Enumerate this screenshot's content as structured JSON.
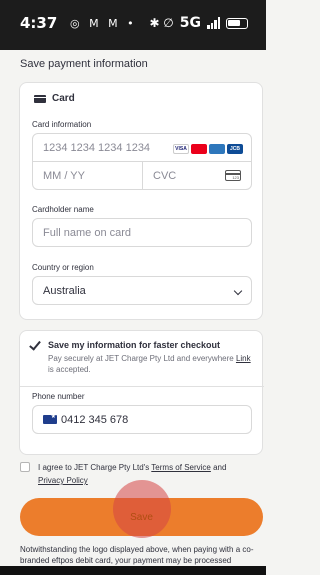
{
  "status_bar": {
    "time": "4:37",
    "left_icons": "◎ M M •",
    "right_icons": "✱ ∅",
    "network": "5G"
  },
  "page": {
    "title": "Save payment information"
  },
  "card_form": {
    "tab_label": "Card",
    "card_info_label": "Card information",
    "card_number_placeholder": "1234 1234 1234 1234",
    "expiry_placeholder": "MM / YY",
    "cvc_placeholder": "CVC",
    "cvc_icon_text": "123",
    "brands": [
      "VISA",
      "MC",
      "AMEX",
      "JCB"
    ],
    "cardholder_label": "Cardholder name",
    "cardholder_placeholder": "Full name on card",
    "country_label": "Country or region",
    "country_value": "Australia"
  },
  "save_info": {
    "checkbox_label": "Save my information for faster checkout",
    "description_prefix": "Pay securely at JET Charge Pty Ltd and everywhere ",
    "link_text": "Link",
    "description_suffix": " is accepted.",
    "phone_label": "Phone number",
    "phone_value": "0412 345 678"
  },
  "terms": {
    "prefix": "I agree to JET Charge Pty Ltd's ",
    "terms_link": "Terms of Service",
    "middle": " and ",
    "privacy_link": "Privacy Policy"
  },
  "actions": {
    "save_label": "Save"
  },
  "footer": {
    "note": "Notwithstanding the logo displayed above, when paying with a co-branded eftpos debit card, your payment may be processed"
  },
  "colors": {
    "accent": "#ec7d2c",
    "status_bar": "#1c1c1c",
    "ripple": "#d64646"
  }
}
